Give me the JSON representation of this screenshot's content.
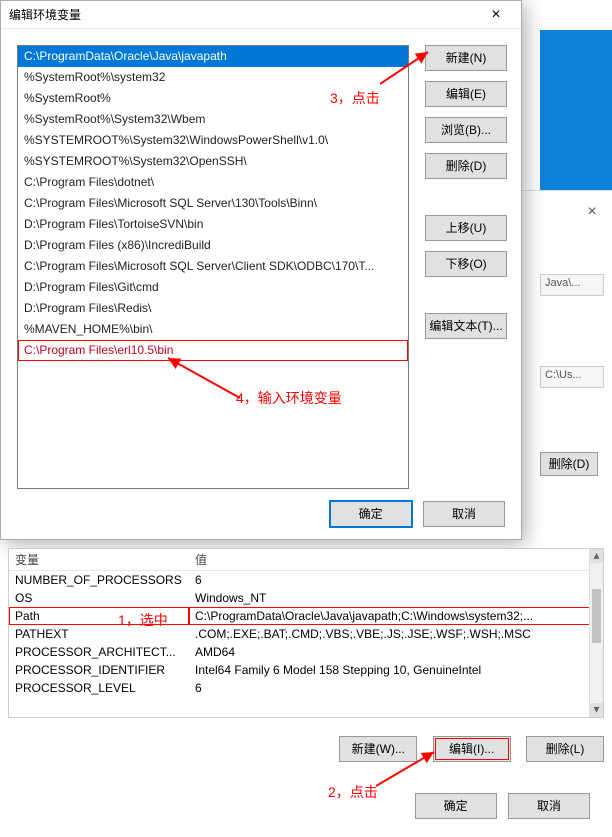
{
  "dialog": {
    "title": "编辑环境变量",
    "items": [
      "C:\\ProgramData\\Oracle\\Java\\javapath",
      "%SystemRoot%\\system32",
      "%SystemRoot%",
      "%SystemRoot%\\System32\\Wbem",
      "%SYSTEMROOT%\\System32\\WindowsPowerShell\\v1.0\\",
      "%SYSTEMROOT%\\System32\\OpenSSH\\",
      "C:\\Program Files\\dotnet\\",
      "C:\\Program Files\\Microsoft SQL Server\\130\\Tools\\Binn\\",
      "D:\\Program Files\\TortoiseSVN\\bin",
      "D:\\Program Files (x86)\\IncrediBuild",
      "C:\\Program Files\\Microsoft SQL Server\\Client SDK\\ODBC\\170\\T...",
      "D:\\Program Files\\Git\\cmd",
      "D:\\Program Files\\Redis\\",
      "%MAVEN_HOME%\\bin\\",
      "C:\\Program Files\\erl10.5\\bin"
    ],
    "buttons": {
      "new": "新建(N)",
      "edit": "编辑(E)",
      "browse": "浏览(B)...",
      "delete": "删除(D)",
      "up": "上移(U)",
      "down": "下移(O)",
      "edittext": "编辑文本(T)...",
      "ok": "确定",
      "cancel": "取消"
    }
  },
  "annotations": {
    "a1": "1，选中",
    "a2": "2，点击",
    "a3": "3，点击",
    "a4": "4，输入环境变量"
  },
  "sysvars": {
    "headers": {
      "name": "变量",
      "value": "值"
    },
    "rows": [
      {
        "name": "NUMBER_OF_PROCESSORS",
        "value": "6"
      },
      {
        "name": "OS",
        "value": "Windows_NT"
      },
      {
        "name": "Path",
        "value": "C:\\ProgramData\\Oracle\\Java\\javapath;C:\\Windows\\system32;..."
      },
      {
        "name": "PATHEXT",
        "value": ".COM;.EXE;.BAT;.CMD;.VBS;.VBE;.JS;.JSE;.WSF;.WSH;.MSC"
      },
      {
        "name": "PROCESSOR_ARCHITECT...",
        "value": "AMD64"
      },
      {
        "name": "PROCESSOR_IDENTIFIER",
        "value": "Intel64 Family 6 Model 158 Stepping 10, GenuineIntel"
      },
      {
        "name": "PROCESSOR_LEVEL",
        "value": "6"
      }
    ],
    "buttons": {
      "new": "新建(W)...",
      "edit": "编辑(I)...",
      "delete": "删除(L)"
    },
    "final": {
      "ok": "确定",
      "cancel": "取消"
    }
  },
  "bg": {
    "stub1": "Java\\...",
    "stub2": "C:\\Us...",
    "del": "删除(D)"
  }
}
